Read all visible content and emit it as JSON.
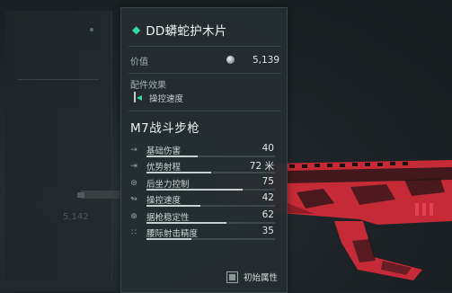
{
  "item": {
    "title": "DD蟒蛇护木片",
    "price_label": "价值",
    "price_value": "5,139",
    "effects_label": "配件效果",
    "effect": "操控速度"
  },
  "weapon": {
    "name": "M7战斗步枪",
    "stats": [
      {
        "label": "基础伤害",
        "value": "40",
        "fill": 0.4,
        "icon": "damage-icon"
      },
      {
        "label": "优势射程",
        "value": "72 米",
        "fill": 0.5,
        "icon": "range-icon"
      },
      {
        "label": "后坐力控制",
        "value": "75",
        "fill": 0.75,
        "icon": "recoil-icon"
      },
      {
        "label": "操控速度",
        "value": "42",
        "fill": 0.42,
        "icon": "handling-icon"
      },
      {
        "label": "据枪稳定性",
        "value": "62",
        "fill": 0.62,
        "icon": "stability-icon"
      },
      {
        "label": "腰际射击精度",
        "value": "35",
        "fill": 0.35,
        "icon": "hipfire-icon"
      }
    ]
  },
  "toggle": {
    "label": "初始属性"
  },
  "background": {
    "left_price": "5,142"
  },
  "colors": {
    "accent": "#38d6a0",
    "gun_red": "#d8323f",
    "panel": "#252d30"
  }
}
